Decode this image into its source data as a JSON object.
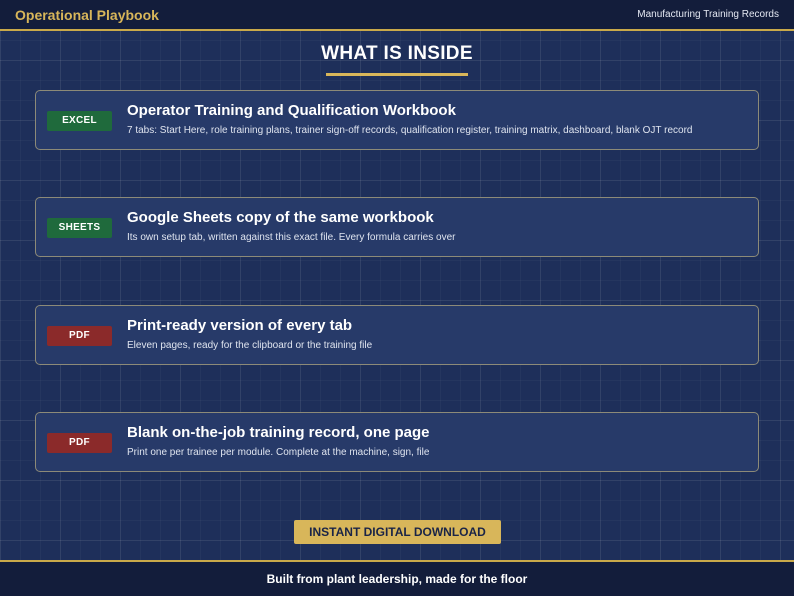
{
  "header": {
    "brand": "Operational Playbook",
    "records_label": "Manufacturing Training Records"
  },
  "main": {
    "heading": "WHAT IS INSIDE",
    "items": [
      {
        "badge": "EXCEL",
        "badge_color": "#1f6a3c",
        "title": "Operator Training and Qualification Workbook",
        "description": "7 tabs: Start Here, role training plans, trainer sign-off records, qualification register, training matrix, dashboard, blank OJT record"
      },
      {
        "badge": "SHEETS",
        "badge_color": "#1f6a3c",
        "title": "Google Sheets copy of the same workbook",
        "description": "Its own setup tab, written against this exact file. Every formula carries over"
      },
      {
        "badge": "PDF",
        "badge_color": "#8b2a2a",
        "title": "Print-ready version of every tab",
        "description": "Eleven pages, ready for the clipboard or the training file"
      },
      {
        "badge": "PDF",
        "badge_color": "#8b2a2a",
        "title": "Blank on-the-job training record, one page",
        "description": "Print one per trainee per module. Complete at the machine, sign, file"
      }
    ],
    "download_label": "INSTANT DIGITAL DOWNLOAD"
  },
  "footer": {
    "tagline": "Built from plant leadership, made for the floor"
  },
  "colors": {
    "background": "#1e2f5a",
    "bar": "#131d3b",
    "accent_gold": "#d8b65a",
    "card": "#273a69"
  }
}
